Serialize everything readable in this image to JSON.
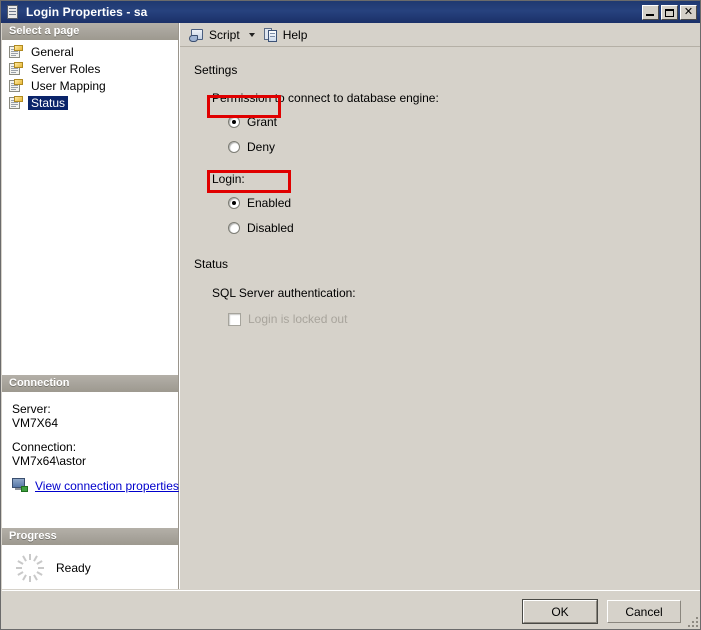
{
  "window": {
    "title": "Login Properties - sa",
    "icon": "window-document-icon",
    "minimize_label": "",
    "maximize_label": "",
    "close_label": "✕"
  },
  "sidebar": {
    "select_page_header": "Select a page",
    "pages": [
      {
        "label": "General",
        "icon": "page-icon",
        "selected": false
      },
      {
        "label": "Server Roles",
        "icon": "page-icon",
        "selected": false
      },
      {
        "label": "User Mapping",
        "icon": "page-icon",
        "selected": false
      },
      {
        "label": "Status",
        "icon": "page-icon",
        "selected": true
      }
    ],
    "connection": {
      "header": "Connection",
      "server_label": "Server:",
      "server_value": "VM7X64",
      "connection_label": "Connection:",
      "connection_value": "VM7x64\\astor",
      "view_properties_link": "View connection properties",
      "link_icon": "network-computer-icon",
      "link_color": "#0000cc"
    },
    "progress": {
      "header": "Progress",
      "status_text": "Ready",
      "icon": "spinner-icon"
    }
  },
  "toolbar": {
    "script_icon": "script-scroll-icon",
    "script_label": "Script",
    "dropdown_icon": "chevron-down-icon",
    "help_icon": "help-pages-icon",
    "help_label": "Help"
  },
  "main": {
    "settings_section_title": "Settings",
    "permission_label": "Permission to connect to database engine:",
    "permission_options": [
      {
        "label": "Grant",
        "checked": true,
        "highlighted": true
      },
      {
        "label": "Deny",
        "checked": false,
        "highlighted": false
      }
    ],
    "login_label": "Login:",
    "login_options": [
      {
        "label": "Enabled",
        "checked": true,
        "highlighted": true
      },
      {
        "label": "Disabled",
        "checked": false,
        "highlighted": false
      }
    ],
    "status_section_title": "Status",
    "auth_label": "SQL Server authentication:",
    "locked_out_checkbox": {
      "label": "Login is locked out",
      "checked": false,
      "disabled": true
    }
  },
  "footer": {
    "ok_label": "OK",
    "cancel_label": "Cancel",
    "resize_grip": "resize-grip"
  },
  "colors": {
    "titlebar": "#27427e",
    "dialog_face": "#d6d2ca",
    "panel_header": "#a8a49c",
    "selection": "#0a246a",
    "highlight_annotation": "#e00000",
    "link": "#0000cc",
    "disabled_text": "#a8a49c"
  }
}
